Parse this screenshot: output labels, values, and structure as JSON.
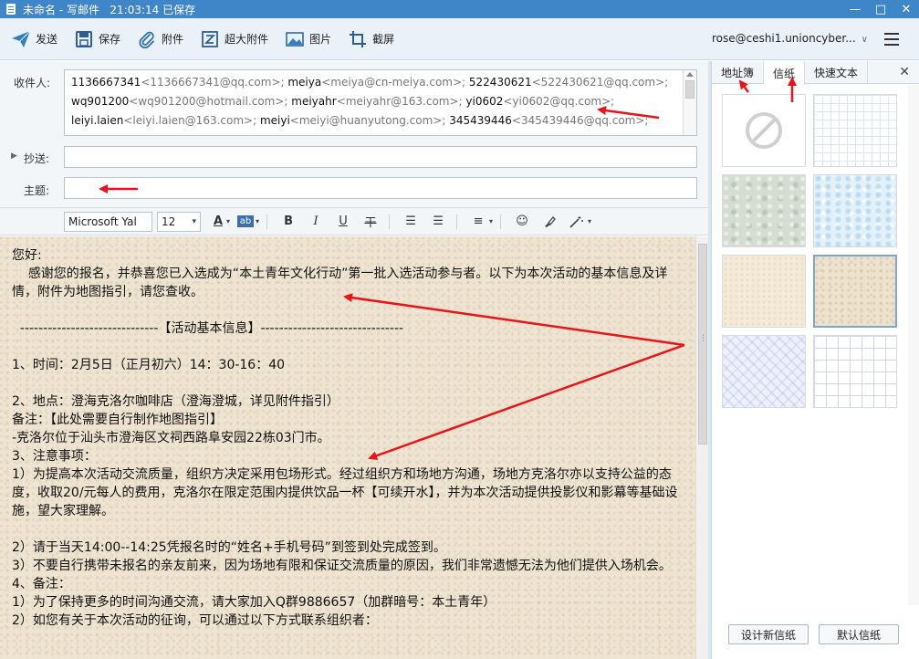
{
  "window": {
    "title": "未命名 - 写邮件   21:03:14 已保存",
    "minimize_glyph": "—",
    "maximize_glyph": "□",
    "close_glyph": "✕"
  },
  "toolbar": {
    "send_label": "发送",
    "save_label": "保存",
    "attach_label": "附件",
    "large_attach_label": "超大附件",
    "image_label": "图片",
    "screenshot_label": "截屏",
    "account": "rose@ceshi1.unioncyber...",
    "account_caret": "∨"
  },
  "compose": {
    "to_label": "收件人:",
    "cc_label": "抄送:",
    "subject_label": "主题:",
    "cc_expand_glyph": "▶",
    "to_recipients": [
      [
        {
          "name": "1136667341",
          "email": "<1136667341@qq.com>; "
        },
        {
          "name": "meiya",
          "email": "<meiya@cn-meiya.com>; "
        },
        {
          "name": "522430621",
          "email": "<522430621@qq.com>;"
        }
      ],
      [
        {
          "name": "wq901200",
          "email": "<wq901200@hotmail.com>; "
        },
        {
          "name": "meiyahr",
          "email": "<meiyahr@163.com>; "
        },
        {
          "name": "yi0602",
          "email": "<yi0602@qq.com>;"
        }
      ],
      [
        {
          "name": "leiyi.laien",
          "email": "<leiyi.laien@163.com>; "
        },
        {
          "name": "meiyi",
          "email": "<meiyi@huanyutong.com>; "
        },
        {
          "name": "345439446",
          "email": "<345439446@qq.com>;"
        }
      ]
    ],
    "cc_value": "",
    "subject_value": ""
  },
  "format": {
    "font_family": "Microsoft Yal",
    "font_size": "12",
    "font_color_glyph": "A",
    "bg_color_glyph": "ab",
    "bold_glyph": "B",
    "italic_glyph": "I",
    "underline_glyph": "U",
    "strike_glyph": "干",
    "bullet_glyph": "☰",
    "number_glyph": "☰",
    "align_glyph": "≡",
    "emoji_glyph": "☺",
    "dropdown_glyph": "▾"
  },
  "body": {
    "lines": [
      "您好:",
      "    感谢您的报名，并恭喜您已入选成为“本土青年文化行动”第一批入选活动参与者。以下为本次活动的基本信息及详情，附件为地图指引，请您查收。",
      "",
      "  ------------------------------【活动基本信息】-------------------------------",
      "",
      "1、时间：2月5日（正月初六）14：30-16：40",
      "",
      "2、地点：澄海克洛尔咖啡店（澄海澄城，详见附件指引）",
      "备注：【此处需要自行制作地图指引】",
      "-克洛尔位于汕头市澄海区文祠西路阜安园22栋03门市。",
      "3、注意事项：",
      "1）为提高本次活动交流质量，组织方决定采用包场形式。经过组织方和场地方沟通，场地方克洛尔亦以支持公益的态度，收取20/元每人的费用，克洛尔在限定范围内提供饮品一杯【可续开水】，并为本次活动提供投影仪和影幕等基础设施，望大家理解。",
      "",
      "2）请于当天14:00--14:25凭报名时的“姓名+手机号码”到签到处完成签到。",
      "3）不要自行携带未报名的亲友前来，因为场地有限和保证交流质量的原因，我们非常遗憾无法为他们提供入场机会。",
      "4、备注：",
      "1）为了保持更多的时间沟通交流，请大家加入Q群9886657（加群暗号：本土青年）",
      "2）如您有关于本次活动的征询，可以通过以下方式联系组织者："
    ]
  },
  "panel": {
    "tabs": [
      "地址簿",
      "信纸",
      "快速文本"
    ],
    "active_tab": "信纸",
    "close_glyph": "✕",
    "design_button": "设计新信纸",
    "default_button": "默认信纸",
    "papers": [
      "none",
      "grid",
      "green",
      "blue",
      "cream",
      "beige",
      "violet",
      "grid2"
    ],
    "selected_paper": "beige"
  },
  "colors": {
    "titlebar": "#3f86c8",
    "annotation_arrow": "#e8141a",
    "paper_bg": "#eee4d1"
  }
}
